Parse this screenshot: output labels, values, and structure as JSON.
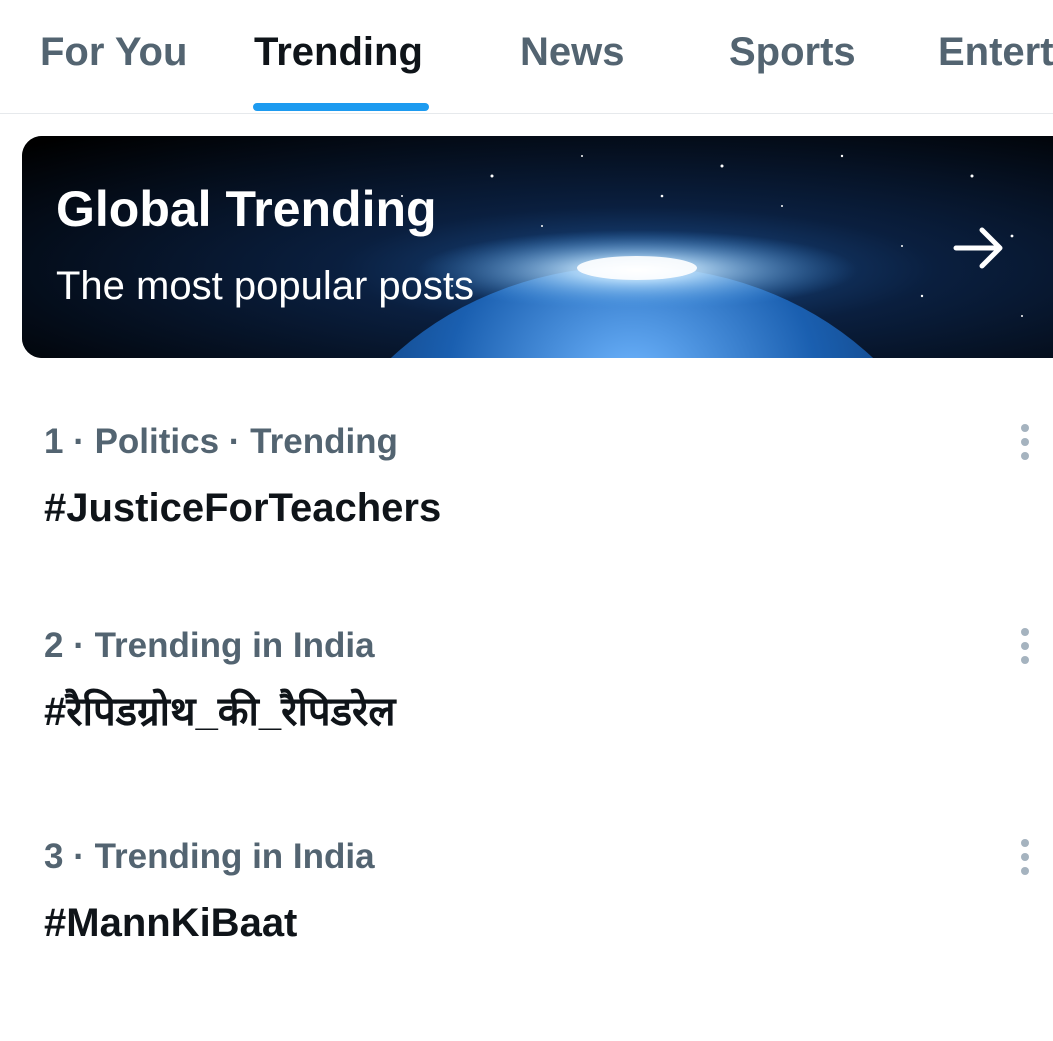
{
  "tabs": [
    {
      "label": "For You",
      "active": false
    },
    {
      "label": "Trending",
      "active": true
    },
    {
      "label": "News",
      "active": false
    },
    {
      "label": "Sports",
      "active": false
    },
    {
      "label": "Entert",
      "active": false
    }
  ],
  "banner": {
    "title": "Global Trending",
    "subtitle": "The most popular posts",
    "icon": "arrow-right-icon"
  },
  "trends": [
    {
      "meta": "1 · Politics · Trending",
      "tag": "#JusticeForTeachers"
    },
    {
      "meta": "2 · Trending in India",
      "tag": "#रैपिडग्रोथ_की_रैपिडरेल"
    },
    {
      "meta": "3 · Trending in India",
      "tag": "#MannKiBaat"
    }
  ],
  "colors": {
    "accent": "#1d9bf0",
    "primary_text": "#0f1419",
    "secondary_text": "#536471"
  }
}
